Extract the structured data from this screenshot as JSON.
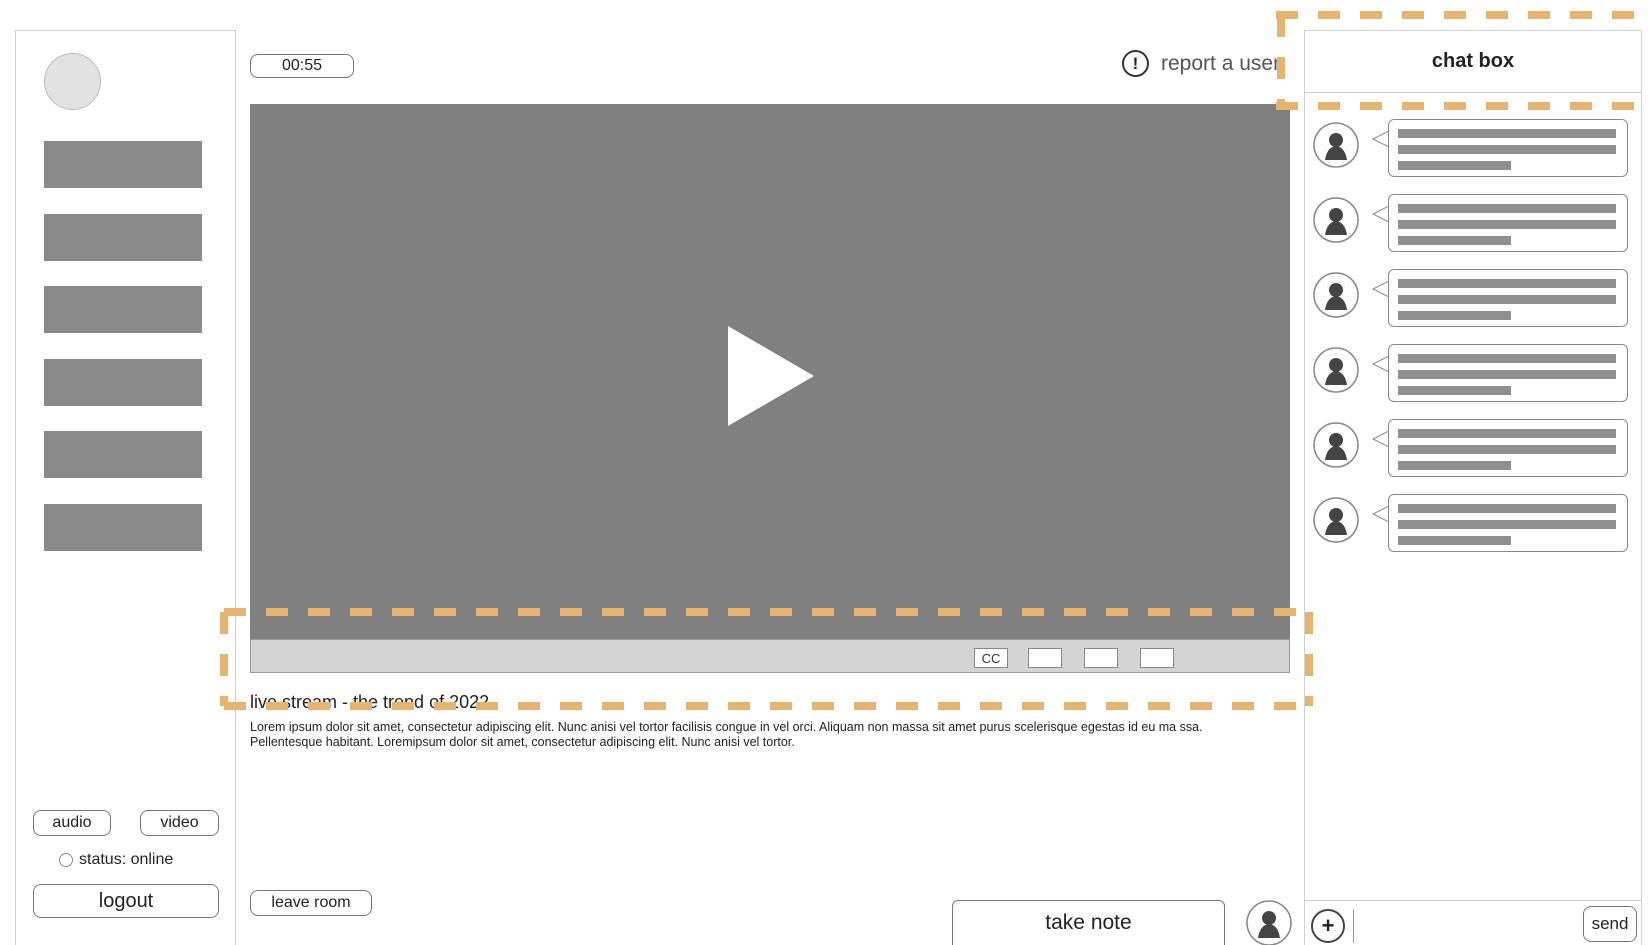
{
  "sidebar": {
    "nav_block_count": 6,
    "audio_label": "audio",
    "video_label": "video",
    "status_text": "status: online",
    "logout_label": "logout"
  },
  "main": {
    "timer": "00:55",
    "report_icon_glyph": "!",
    "report_label": "report a user",
    "controls": {
      "cc_label": "CC"
    },
    "video_title": "live stream - the trend of 2022",
    "video_description": "Lorem ipsum dolor sit amet, consectetur adipiscing elit. Nunc anisi vel tortor facilisis congue in vel orci. Aliquam non massa sit amet purus scelerisque egestas id eu ma ssa. Pellentesque habitant. Loremipsum dolor sit amet, consectetur adipiscing elit. Nunc anisi vel tortor.",
    "leave_label": "leave room",
    "take_note_label": "take note"
  },
  "chat": {
    "title": "chat box",
    "message_count": 6,
    "plus_glyph": "+",
    "send_label": "send"
  },
  "colors": {
    "video_bg": "#808080",
    "nav_block": "#8a8a8a",
    "annotation": "#e6b46e"
  }
}
